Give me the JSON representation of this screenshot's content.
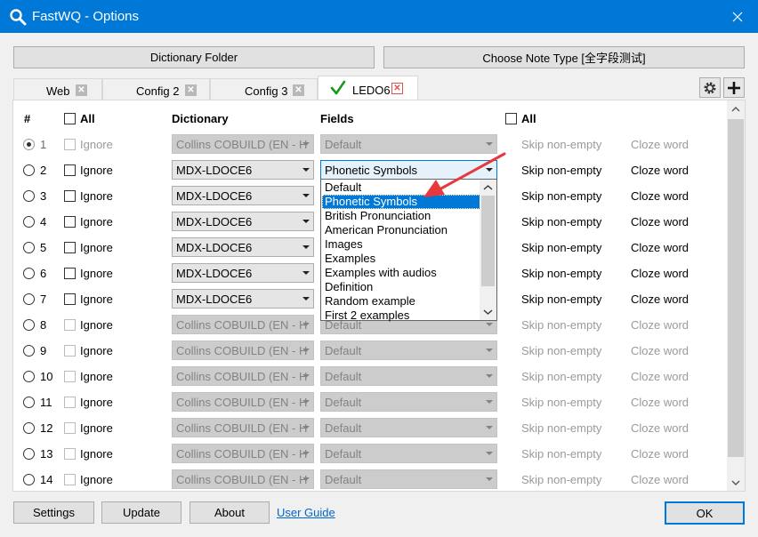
{
  "window": {
    "title": "FastWQ - Options"
  },
  "toolbar": {
    "dict_folder": "Dictionary Folder",
    "note_type": "Choose Note Type [全字段测试]"
  },
  "tabs": [
    {
      "label": "Web"
    },
    {
      "label": "Config 2"
    },
    {
      "label": "Config 3"
    },
    {
      "label": "LEDO6"
    }
  ],
  "headers": {
    "num": "#",
    "all": "All",
    "dictionary": "Dictionary",
    "fields": "Fields",
    "all2": "All"
  },
  "rows": [
    {
      "num": "1",
      "ignore": "Ignore",
      "dict": "Collins COBUILD (EN - H",
      "field": "Default",
      "skip": "Skip non-empty",
      "cloze": "Cloze word"
    },
    {
      "num": "2",
      "ignore": "Ignore",
      "dict": "MDX-LDOCE6",
      "field": "Phonetic Symbols",
      "skip": "Skip non-empty",
      "cloze": "Cloze word"
    },
    {
      "num": "3",
      "ignore": "Ignore",
      "dict": "MDX-LDOCE6",
      "field": "",
      "skip": "Skip non-empty",
      "cloze": "Cloze word"
    },
    {
      "num": "4",
      "ignore": "Ignore",
      "dict": "MDX-LDOCE6",
      "field": "",
      "skip": "Skip non-empty",
      "cloze": "Cloze word"
    },
    {
      "num": "5",
      "ignore": "Ignore",
      "dict": "MDX-LDOCE6",
      "field": "",
      "skip": "Skip non-empty",
      "cloze": "Cloze word"
    },
    {
      "num": "6",
      "ignore": "Ignore",
      "dict": "MDX-LDOCE6",
      "field": "",
      "skip": "Skip non-empty",
      "cloze": "Cloze word"
    },
    {
      "num": "7",
      "ignore": "Ignore",
      "dict": "MDX-LDOCE6",
      "field": "",
      "skip": "Skip non-empty",
      "cloze": "Cloze word"
    },
    {
      "num": "8",
      "ignore": "Ignore",
      "dict": "Collins COBUILD (EN - H",
      "field": "Default",
      "skip": "Skip non-empty",
      "cloze": "Cloze word"
    },
    {
      "num": "9",
      "ignore": "Ignore",
      "dict": "Collins COBUILD (EN - H",
      "field": "Default",
      "skip": "Skip non-empty",
      "cloze": "Cloze word"
    },
    {
      "num": "10",
      "ignore": "Ignore",
      "dict": "Collins COBUILD (EN - H",
      "field": "Default",
      "skip": "Skip non-empty",
      "cloze": "Cloze word"
    },
    {
      "num": "11",
      "ignore": "Ignore",
      "dict": "Collins COBUILD (EN - H",
      "field": "Default",
      "skip": "Skip non-empty",
      "cloze": "Cloze word"
    },
    {
      "num": "12",
      "ignore": "Ignore",
      "dict": "Collins COBUILD (EN - H",
      "field": "Default",
      "skip": "Skip non-empty",
      "cloze": "Cloze word"
    },
    {
      "num": "13",
      "ignore": "Ignore",
      "dict": "Collins COBUILD (EN - H",
      "field": "Default",
      "skip": "Skip non-empty",
      "cloze": "Cloze word"
    },
    {
      "num": "14",
      "ignore": "Ignore",
      "dict": "Collins COBUILD (EN - H",
      "field": "Default",
      "skip": "Skip non-empty",
      "cloze": "Cloze word"
    }
  ],
  "dropdown": {
    "options": [
      "Default",
      "Phonetic Symbols",
      "British Pronunciation",
      "American Pronunciation",
      "Images",
      "Examples",
      "Examples with audios",
      "Definition",
      "Random example",
      "First 2 examples"
    ]
  },
  "footer": {
    "settings": "Settings",
    "update": "Update",
    "about": "About",
    "guide": "User Guide",
    "ok": "OK"
  },
  "colors": {
    "titlebar": "#0078d7",
    "accent": "#0078d7",
    "annotation_arrow": "#e8373d",
    "active_tab_check": "#1a9a1a"
  }
}
